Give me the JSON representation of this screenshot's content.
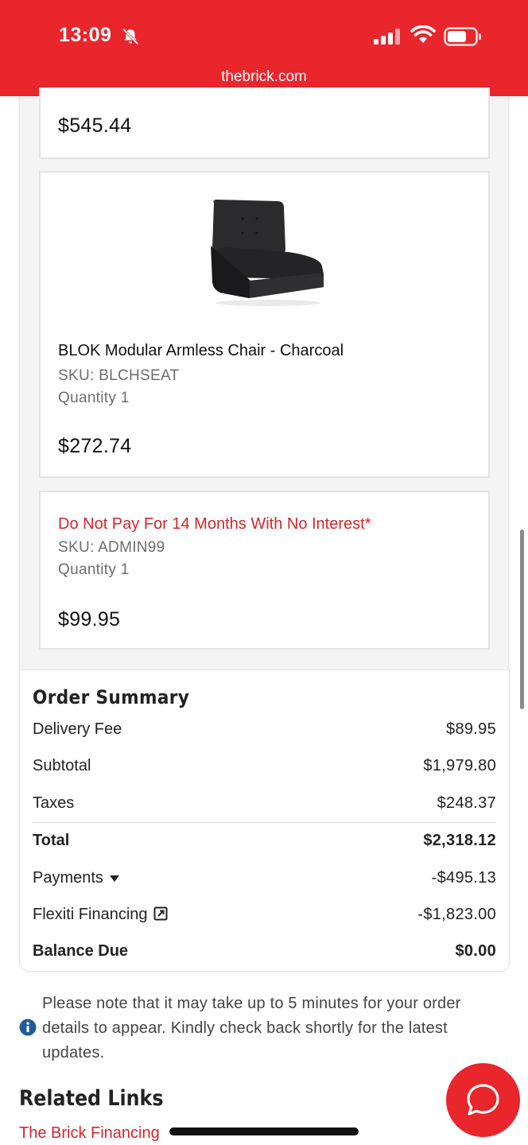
{
  "status": {
    "time": "13:09",
    "url": "thebrick.com"
  },
  "items": [
    {
      "price": "$545.44"
    },
    {
      "name": "BLOK Modular Armless Chair - Charcoal",
      "sku": "SKU: BLCHSEAT",
      "quantity": "Quantity 1",
      "price": "$272.74"
    },
    {
      "name": "Do Not Pay For 14 Months With No Interest*",
      "sku": "SKU: ADMIN99",
      "quantity": "Quantity 1",
      "price": "$99.95"
    }
  ],
  "summary": {
    "title": "Order Summary",
    "delivery_label": "Delivery Fee",
    "delivery_value": "$89.95",
    "subtotal_label": "Subtotal",
    "subtotal_value": "$1,979.80",
    "taxes_label": "Taxes",
    "taxes_value": "$248.37",
    "total_label": "Total",
    "total_value": "$2,318.12",
    "payments_label": "Payments",
    "payments_value": "-$495.13",
    "financing_label": "Flexiti Financing",
    "financing_value": "-$1,823.00",
    "balance_label": "Balance Due",
    "balance_value": "$0.00"
  },
  "note": "Please note that it may take up to 5 minutes for your order details to appear. Kindly check back shortly for the latest updates.",
  "related": {
    "title": "Related Links",
    "link_1": "The Brick Financing"
  },
  "colors": {
    "brand_red": "#e8262c",
    "promo_red": "#d6252b",
    "info_blue": "#1f5d99"
  },
  "icons": [
    "bell-slash-icon",
    "cellular-signal-icon",
    "wifi-icon",
    "battery-icon",
    "caret-down-icon",
    "external-link-icon",
    "info-icon",
    "chat-bubble-icon"
  ]
}
